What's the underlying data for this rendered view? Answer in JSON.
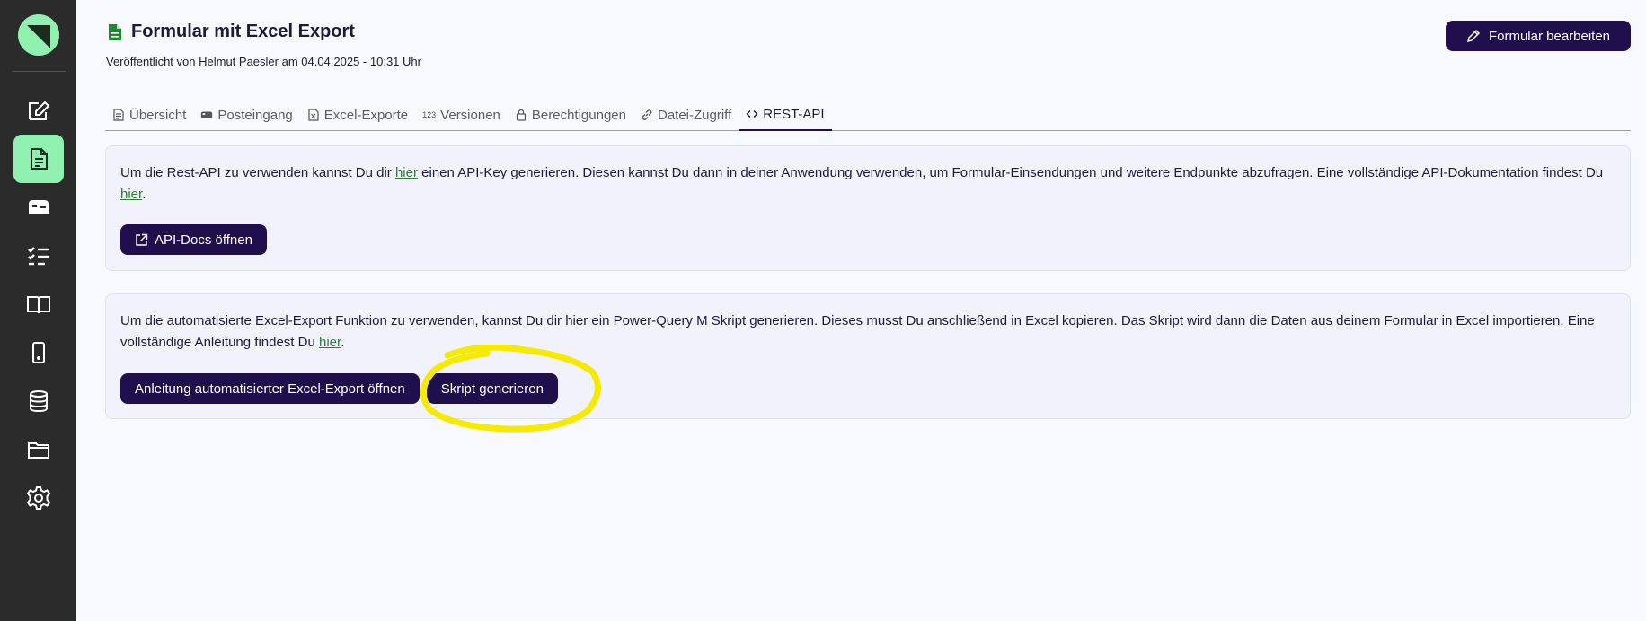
{
  "sidebar": {
    "items": [
      {
        "icon": "form-edit-icon",
        "active": false
      },
      {
        "icon": "document-icon",
        "active": true
      },
      {
        "icon": "inbox-icon",
        "active": false
      },
      {
        "icon": "checklist-icon",
        "active": false
      },
      {
        "icon": "book-icon",
        "active": false
      },
      {
        "icon": "mobile-icon",
        "active": false
      },
      {
        "icon": "database-icon",
        "active": false
      },
      {
        "icon": "folder-icon",
        "active": false
      },
      {
        "icon": "gear-icon",
        "active": false
      }
    ]
  },
  "header": {
    "title": "Formular mit Excel Export",
    "subtitle": "Veröffentlicht von Helmut Paesler am 04.04.2025 - 10:31 Uhr",
    "edit_button": "Formular bearbeiten"
  },
  "tabs": [
    {
      "label": "Übersicht",
      "icon": "file-text-icon"
    },
    {
      "label": "Posteingang",
      "icon": "mailbox-icon"
    },
    {
      "label": "Excel-Exporte",
      "icon": "excel-file-icon"
    },
    {
      "label": "Versionen",
      "icon": "123"
    },
    {
      "label": "Berechtigungen",
      "icon": "lock-icon"
    },
    {
      "label": "Datei-Zugriff",
      "icon": "link-icon"
    },
    {
      "label": "REST-API",
      "icon": "code-icon",
      "active": true
    }
  ],
  "rest_card": {
    "text_1": "Um die Rest-API zu verwenden kannst Du dir ",
    "link_1": "hier",
    "text_2": " einen API-Key generieren. Diesen kannst Du dann in deiner Anwendung verwenden, um Formular-Einsendungen und weitere Endpunkte abzufragen. Eine vollständige API-Dokumentation findest Du ",
    "link_2": "hier",
    "text_3": ".",
    "button": "API-Docs öffnen"
  },
  "excel_card": {
    "text_1": "Um die automatisierte Excel-Export Funktion zu verwenden, kannst Du dir hier ein Power-Query M Skript generieren. Dieses musst Du anschließend in Excel kopieren. Das Skript wird dann die Daten aus deinem Formular in Excel importieren. Eine vollständige Anleitung findest Du ",
    "link_1": "hier",
    "text_2": ".",
    "button_guide": "Anleitung automatisierter Excel-Export öffnen",
    "button_script": "Skript generieren"
  },
  "colors": {
    "sidebar_bg": "#2b2b2b",
    "accent_green": "#8ff0b0",
    "primary": "#1f0f4d",
    "highlight": "#f5ea00"
  }
}
